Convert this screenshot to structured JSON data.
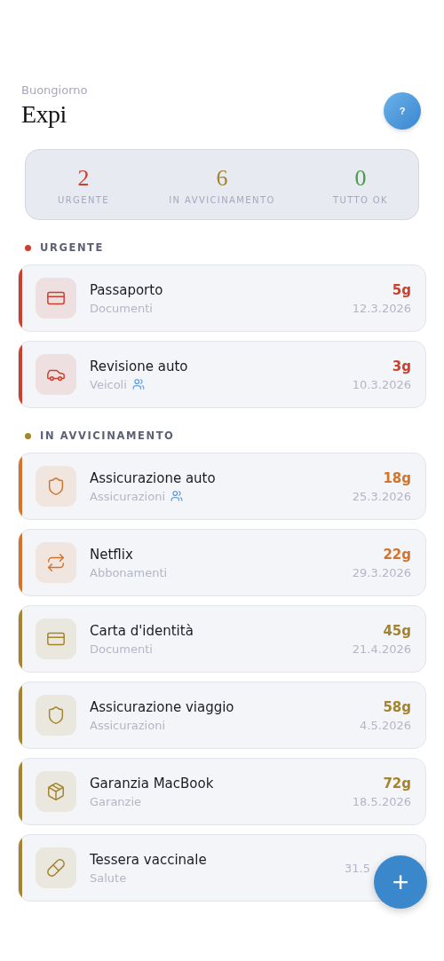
{
  "header": {
    "greeting": "Buongiorno",
    "title": "Expi",
    "help_button": "?"
  },
  "summary": [
    {
      "count": "2",
      "label": "URGENTE",
      "color": "#c9402f"
    },
    {
      "count": "6",
      "label": "IN AVVICINAMENTO",
      "color": "#a4842c"
    },
    {
      "count": "0",
      "label": "TUTTO OK",
      "color": "#4c9a4c"
    }
  ],
  "sections": [
    {
      "title": "URGENTE",
      "color": "#c9402f",
      "items": [
        {
          "kind": "card",
          "name": "Passaporto",
          "category": "Documenti",
          "shared": false,
          "days": "5g",
          "date": "12.3.2026",
          "color": "#c9402f"
        },
        {
          "kind": "car",
          "name": "Revisione auto",
          "category": "Veicoli",
          "shared": true,
          "days": "3g",
          "date": "10.3.2026",
          "color": "#c9402f"
        }
      ]
    },
    {
      "title": "IN AVVICINAMENTO",
      "color": "#a4842c",
      "items": [
        {
          "kind": "shield",
          "name": "Assicurazione auto",
          "category": "Assicurazioni",
          "shared": true,
          "days": "18g",
          "date": "25.3.2026",
          "color": "#d2742a"
        },
        {
          "kind": "repeat",
          "name": "Netflix",
          "category": "Abbonamenti",
          "shared": false,
          "days": "22g",
          "date": "29.3.2026",
          "color": "#d2742a"
        },
        {
          "kind": "card",
          "name": "Carta d'identità",
          "category": "Documenti",
          "shared": false,
          "days": "45g",
          "date": "21.4.2026",
          "color": "#a4842c"
        },
        {
          "kind": "shield",
          "name": "Assicurazione viaggio",
          "category": "Assicurazioni",
          "shared": false,
          "days": "58g",
          "date": "4.5.2026",
          "color": "#a4842c"
        },
        {
          "kind": "package",
          "name": "Garanzia MacBook",
          "category": "Garanzie",
          "shared": false,
          "days": "72g",
          "date": "18.5.2026",
          "color": "#a4842c"
        },
        {
          "kind": "pill",
          "name": "Tessera vaccinale",
          "category": "Salute",
          "shared": false,
          "date": "31.5",
          "color": "#a4842c"
        }
      ]
    }
  ],
  "add_button": "+"
}
